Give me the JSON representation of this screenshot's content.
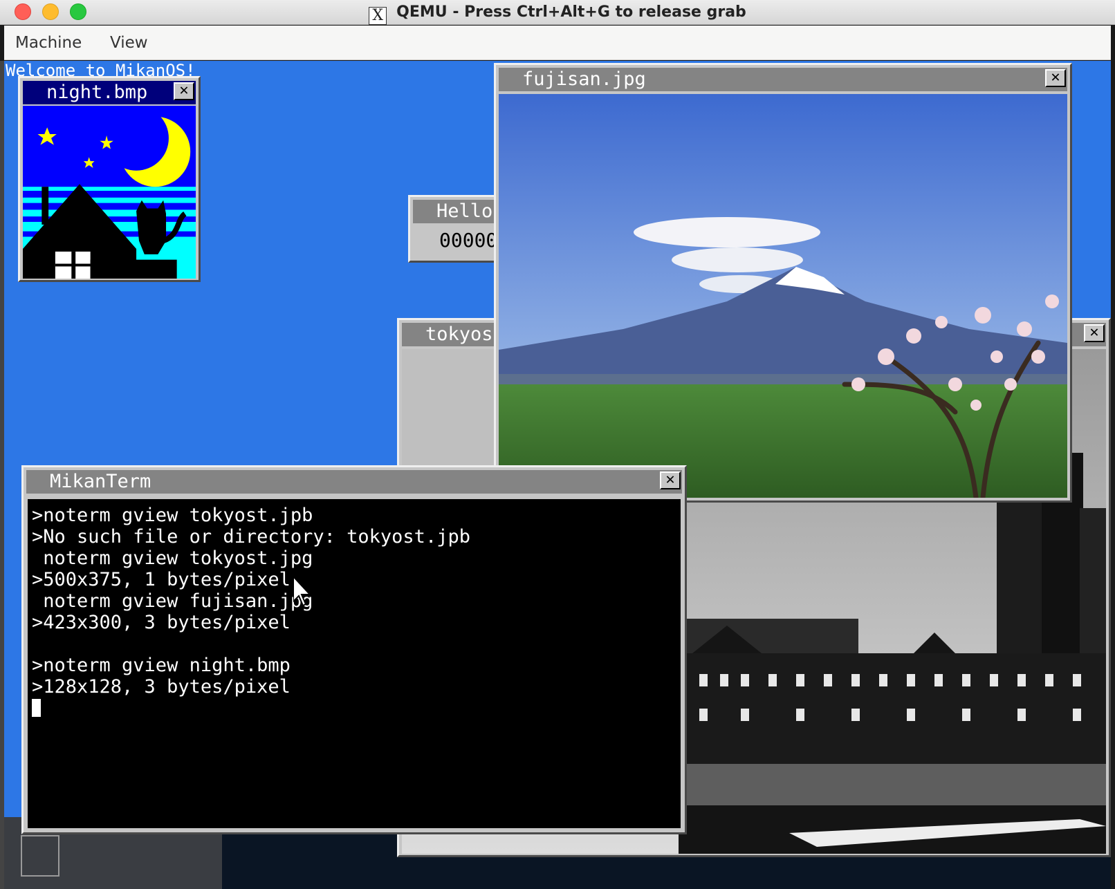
{
  "host": {
    "title": "QEMU - Press Ctrl+Alt+G to release grab",
    "menus": [
      "Machine",
      "View"
    ]
  },
  "desktop": {
    "welcome": "Welcome to MikanOS!"
  },
  "windows": {
    "night": {
      "title": "night.bmp",
      "close": "✕"
    },
    "hello": {
      "title": "Hello",
      "counter": "00000"
    },
    "tokyost": {
      "title": "tokyost.jpg",
      "close": "✕"
    },
    "fujisan": {
      "title": "fujisan.jpg",
      "close": "✕"
    },
    "term": {
      "title": "MikanTerm",
      "close": "✕",
      "lines": [
        ">noterm gview tokyost.jpb",
        ">No such file or directory: tokyost.jpb",
        " noterm gview tokyost.jpg",
        ">500x375, 1 bytes/pixel",
        " noterm gview fujisan.jpg",
        ">423x300, 3 bytes/pixel",
        "",
        ">noterm gview night.bmp",
        ">128x128, 3 bytes/pixel"
      ]
    }
  },
  "icons": {
    "window_close": "close-icon",
    "mouse": "mouse-pointer-icon"
  },
  "colors": {
    "desktop_bg": "#2d77e6",
    "window_face": "#c6c6c6",
    "active_title": "#00007b",
    "inactive_title": "#848484"
  }
}
